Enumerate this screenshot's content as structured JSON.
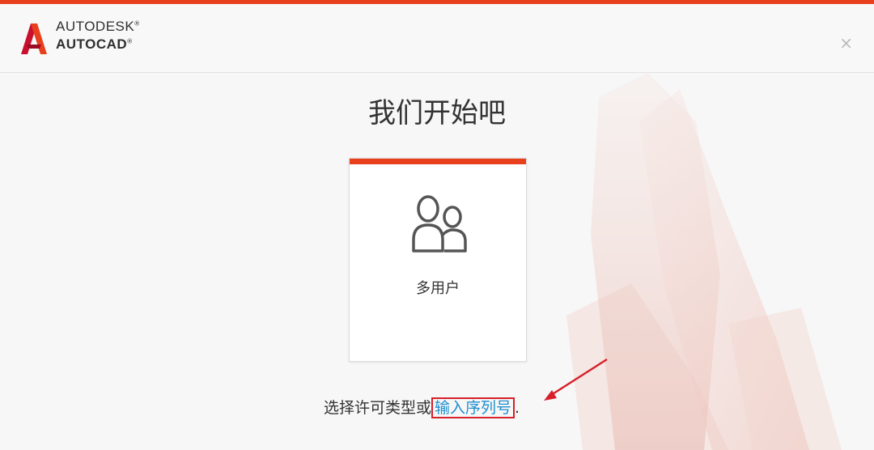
{
  "brand": {
    "line1": "AUTODESK",
    "line1_mark": "®",
    "line2": "AUTOCAD",
    "line2_mark": "®"
  },
  "header": {
    "close_symbol": "×"
  },
  "title": "我们开始吧",
  "card": {
    "label": "多用户",
    "icon": "multi-user-icon"
  },
  "footer": {
    "prefix": "选择许可类型或",
    "link": "输入序列号",
    "suffix": "."
  },
  "colors": {
    "accent": "#e8401c",
    "link": "#1f8fd0",
    "annotation": "#d6202a"
  }
}
